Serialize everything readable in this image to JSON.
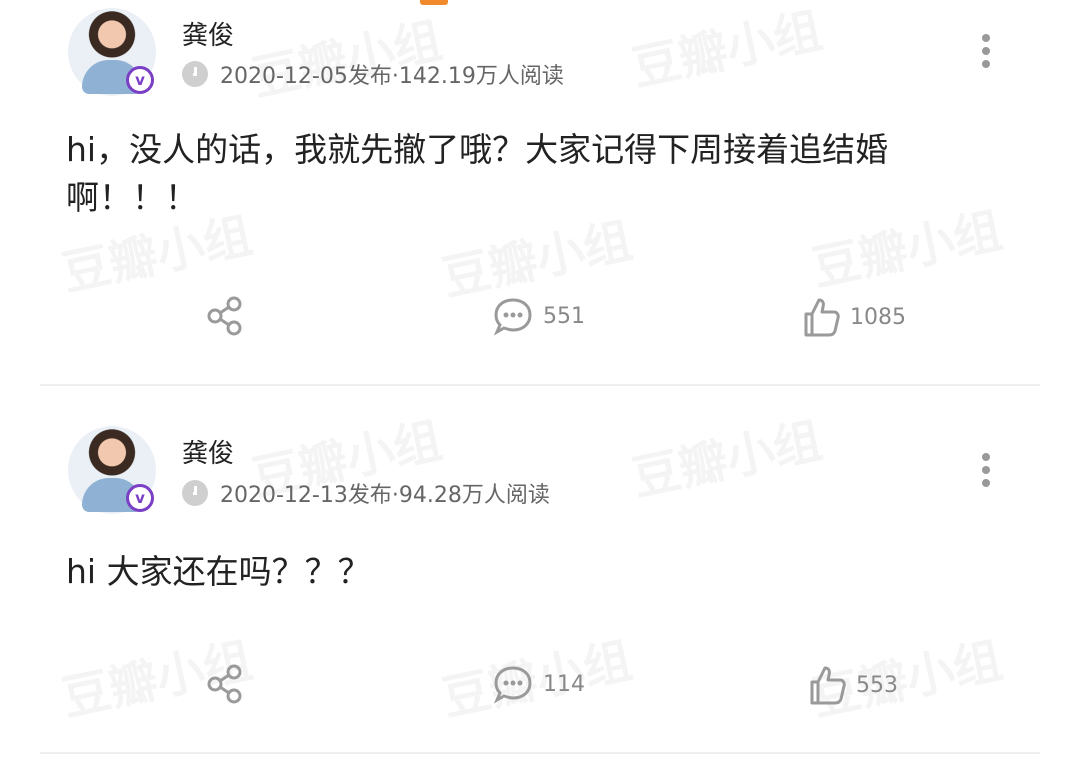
{
  "watermark_text": "豆瓣小组",
  "posts": [
    {
      "username": "龚俊",
      "meta": "2020-12-05发布·142.19万人阅读",
      "content": "hi，没人的话，我就先撤了哦？大家记得下周接着追结婚啊！！！",
      "comments": "551",
      "likes": "1085"
    },
    {
      "username": "龚俊",
      "meta": "2020-12-13发布·94.28万人阅读",
      "content": "hi 大家还在吗？？？",
      "comments": "114",
      "likes": "553"
    }
  ],
  "colors": {
    "accent": "#f08a2c",
    "verified": "#7b3fc6",
    "icon": "#9a9a9a"
  }
}
